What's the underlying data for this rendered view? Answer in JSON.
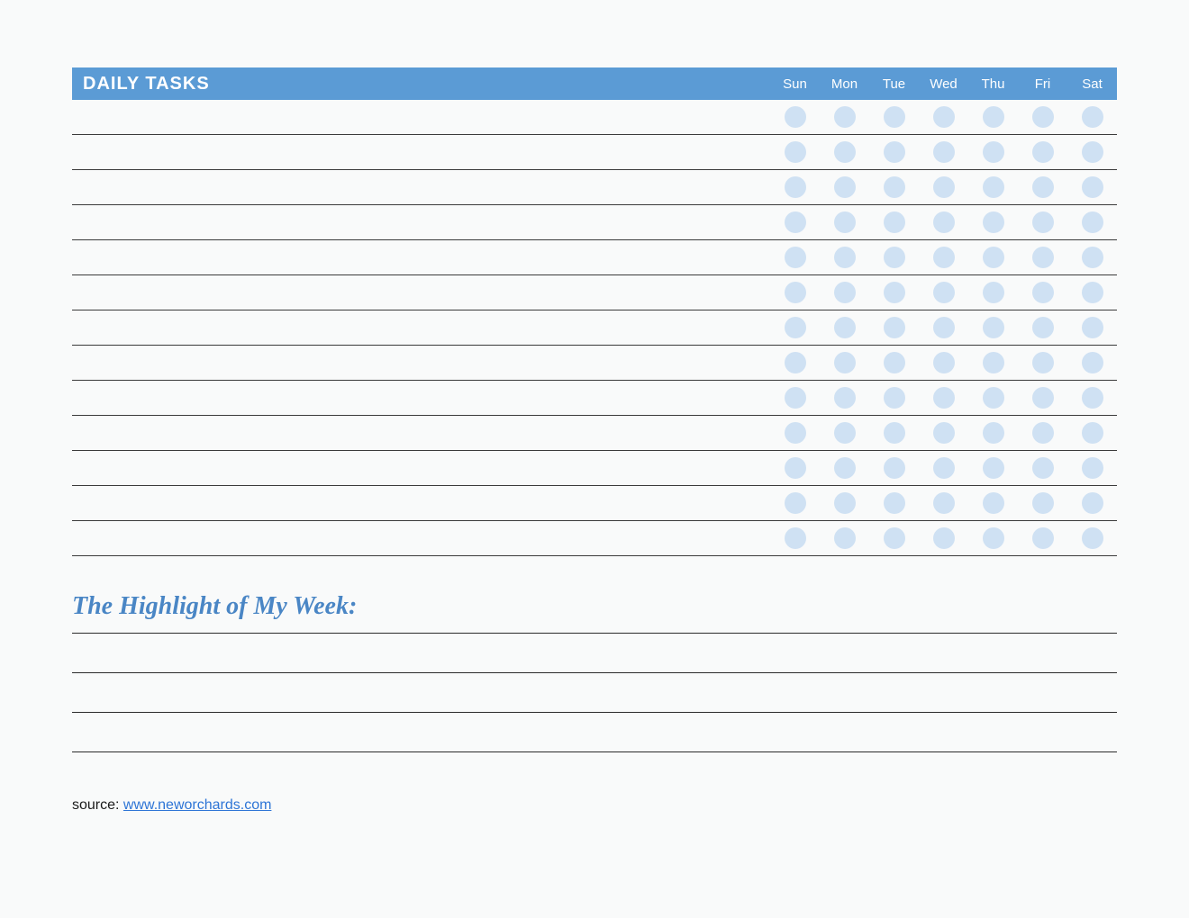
{
  "header": {
    "title": "DAILY TASKS",
    "days": [
      "Sun",
      "Mon",
      "Tue",
      "Wed",
      "Thu",
      "Fri",
      "Sat"
    ]
  },
  "tasks": {
    "row_count": 13
  },
  "highlight": {
    "title": "The Highlight of My Week:",
    "line_count": 3
  },
  "source": {
    "label": "source: ",
    "link_text": "www.neworchards.com"
  }
}
